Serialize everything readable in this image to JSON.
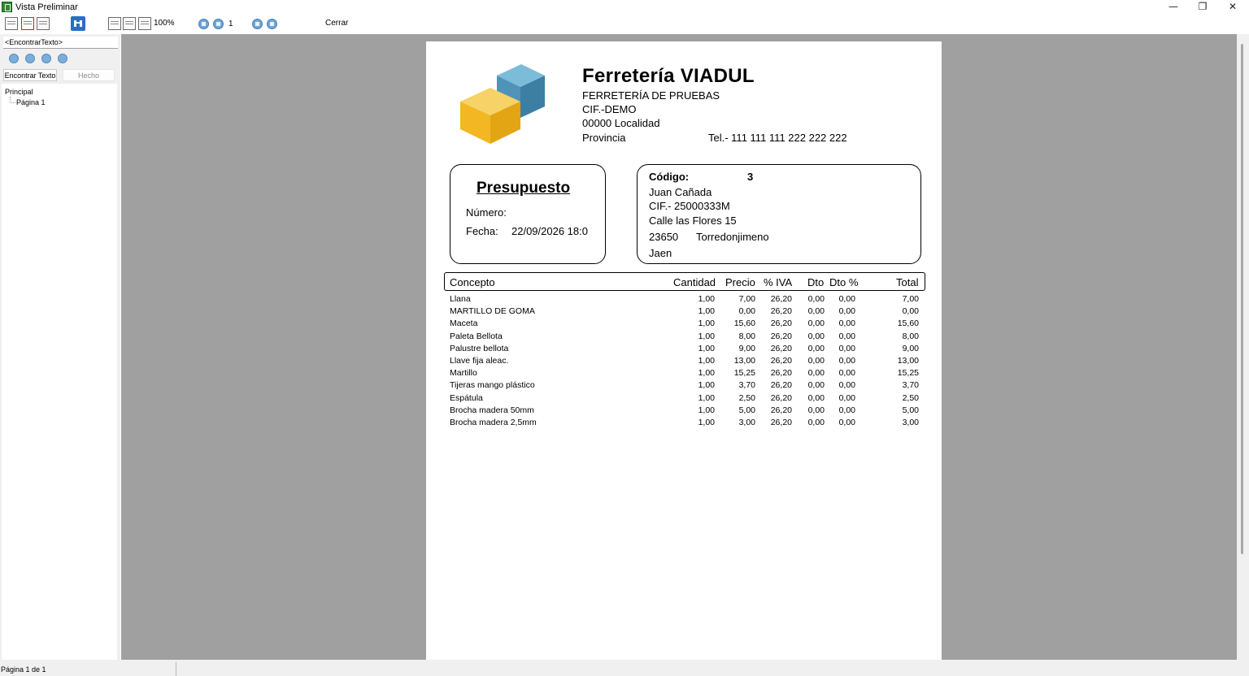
{
  "window": {
    "title": "Vista Preliminar",
    "controls": {
      "minimize": "—",
      "restore": "❐",
      "close": "✕"
    }
  },
  "toolbar": {
    "zoom": "100%",
    "page_value": "1",
    "close_label": "Cerrar"
  },
  "sidebar": {
    "search_value": "<EncontrarTexto>",
    "find_button": "Encontrar Texto",
    "done_button": "Hecho",
    "tree_root": "Principal",
    "tree_child": "Página 1"
  },
  "document": {
    "company": {
      "name": "Ferretería VIADUL",
      "subtitle": "FERRETERÍA DE PRUEBAS",
      "cif": "CIF.-DEMO",
      "locality": "00000 Localidad",
      "province": "Provincia",
      "phone": "Tel.- 111 111 111  222 222 222"
    },
    "budget": {
      "title": "Presupuesto",
      "number_label": "Número:",
      "date_label": "Fecha:",
      "date_value": "22/09/2026 18:0"
    },
    "client": {
      "code_label": "Código:",
      "code_value": "3",
      "name": "Juan Cañada",
      "cif": "CIF.-  25000333M",
      "address": "Calle las Flores 15",
      "postal_code": "23650",
      "city": "Torredonjimeno",
      "province": "Jaen"
    },
    "table": {
      "headers": {
        "concept": "Concepto",
        "quantity": "Cantidad",
        "price": "Precio",
        "iva": "% IVA",
        "dto": "Dto",
        "dto_pct": "Dto %",
        "total": "Total"
      },
      "rows": [
        {
          "concept": "Llana",
          "quantity": "1,00",
          "price": "7,00",
          "iva": "26,20",
          "dto": "0,00",
          "dto_pct": "0,00",
          "total": "7,00"
        },
        {
          "concept": "MARTILLO DE GOMA",
          "quantity": "1,00",
          "price": "0,00",
          "iva": "26,20",
          "dto": "0,00",
          "dto_pct": "0,00",
          "total": "0,00"
        },
        {
          "concept": "Maceta",
          "quantity": "1,00",
          "price": "15,60",
          "iva": "26,20",
          "dto": "0,00",
          "dto_pct": "0,00",
          "total": "15,60"
        },
        {
          "concept": "Paleta Bellota",
          "quantity": "1,00",
          "price": "8,00",
          "iva": "26,20",
          "dto": "0,00",
          "dto_pct": "0,00",
          "total": "8,00"
        },
        {
          "concept": "Palustre bellota",
          "quantity": "1,00",
          "price": "9,00",
          "iva": "26,20",
          "dto": "0,00",
          "dto_pct": "0,00",
          "total": "9,00"
        },
        {
          "concept": "Llave fija aleac.",
          "quantity": "1,00",
          "price": "13,00",
          "iva": "26,20",
          "dto": "0,00",
          "dto_pct": "0,00",
          "total": "13,00"
        },
        {
          "concept": "Martillo",
          "quantity": "1,00",
          "price": "15,25",
          "iva": "26,20",
          "dto": "0,00",
          "dto_pct": "0,00",
          "total": "15,25"
        },
        {
          "concept": "Tijeras mango plástico",
          "quantity": "1,00",
          "price": "3,70",
          "iva": "26,20",
          "dto": "0,00",
          "dto_pct": "0,00",
          "total": "3,70"
        },
        {
          "concept": "Espátula",
          "quantity": "1,00",
          "price": "2,50",
          "iva": "26,20",
          "dto": "0,00",
          "dto_pct": "0,00",
          "total": "2,50"
        },
        {
          "concept": "Brocha madera 50mm",
          "quantity": "1,00",
          "price": "5,00",
          "iva": "26,20",
          "dto": "0,00",
          "dto_pct": "0,00",
          "total": "5,00"
        },
        {
          "concept": "Brocha madera 2,5mm",
          "quantity": "1,00",
          "price": "3,00",
          "iva": "26,20",
          "dto": "0,00",
          "dto_pct": "0,00",
          "total": "3,00"
        }
      ]
    }
  },
  "statusbar": {
    "text": "Página 1 de 1"
  },
  "colors": {
    "preview_background": "#a0a0a0",
    "panel_background": "#f0f0f0",
    "logo_yellow": "#f2b722",
    "logo_blue": "#5a9fc2"
  }
}
